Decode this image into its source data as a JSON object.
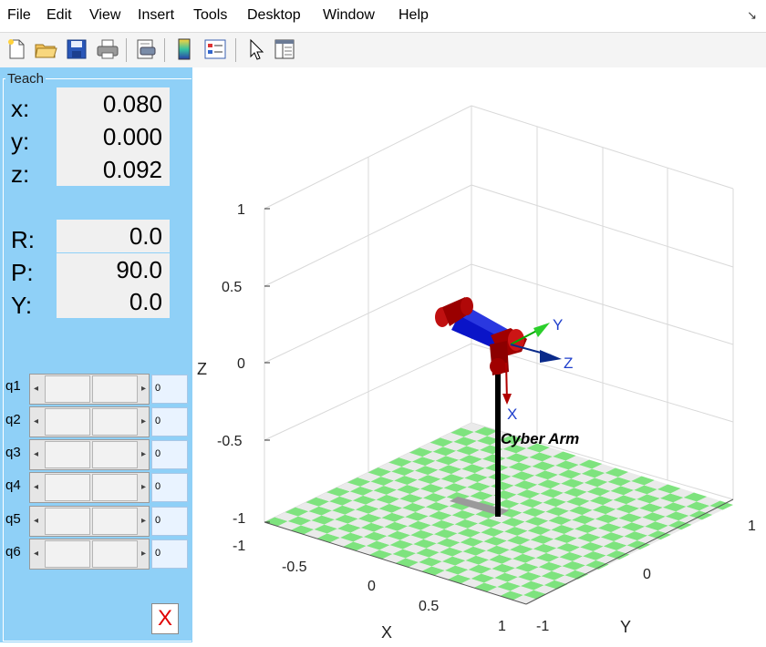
{
  "menu": [
    "File",
    "Edit",
    "View",
    "Insert",
    "Tools",
    "Desktop",
    "Window",
    "Help"
  ],
  "dock_arrow": "↘",
  "toolbar_icons": [
    "new-file-icon",
    "open-folder-icon",
    "save-icon",
    "print-icon",
    "print-preview-icon",
    "colorbar-icon",
    "legend-icon",
    "pointer-icon",
    "property-editor-icon"
  ],
  "teach": {
    "title": "Teach",
    "position": [
      {
        "label": "x:",
        "value": "0.080"
      },
      {
        "label": "y:",
        "value": "0.000"
      },
      {
        "label": "z:",
        "value": "0.092"
      }
    ],
    "orientation": [
      {
        "label": "R:",
        "value": "0.0"
      },
      {
        "label": "P:",
        "value": "90.0"
      },
      {
        "label": "Y:",
        "value": "0.0"
      }
    ],
    "joints": [
      {
        "label": "q1",
        "value": "0"
      },
      {
        "label": "q2",
        "value": "0"
      },
      {
        "label": "q3",
        "value": "0"
      },
      {
        "label": "q4",
        "value": "0"
      },
      {
        "label": "q5",
        "value": "0"
      },
      {
        "label": "q6",
        "value": "0"
      }
    ],
    "close_label": "X"
  },
  "plot": {
    "robot_name": "Cyber Arm",
    "zlabel": "Z",
    "xlabel": "X",
    "ylabel": "Y",
    "z_ticks": [
      "1",
      "0.5",
      "0",
      "-0.5",
      "-1"
    ],
    "x_ticks": [
      "-1",
      "-0.5",
      "0",
      "0.5",
      "1"
    ],
    "y_ticks": [
      "-1",
      "0",
      "1"
    ],
    "frame_axes": [
      "X",
      "Y",
      "Z"
    ],
    "colors": {
      "link": "#0000cc",
      "joint": "#a00000",
      "floor_a": "#7ee37e",
      "floor_b": "#eaeaea",
      "frame_x": "#b00000",
      "frame_y": "#00aa00",
      "frame_z": "#0a2a8a"
    }
  }
}
